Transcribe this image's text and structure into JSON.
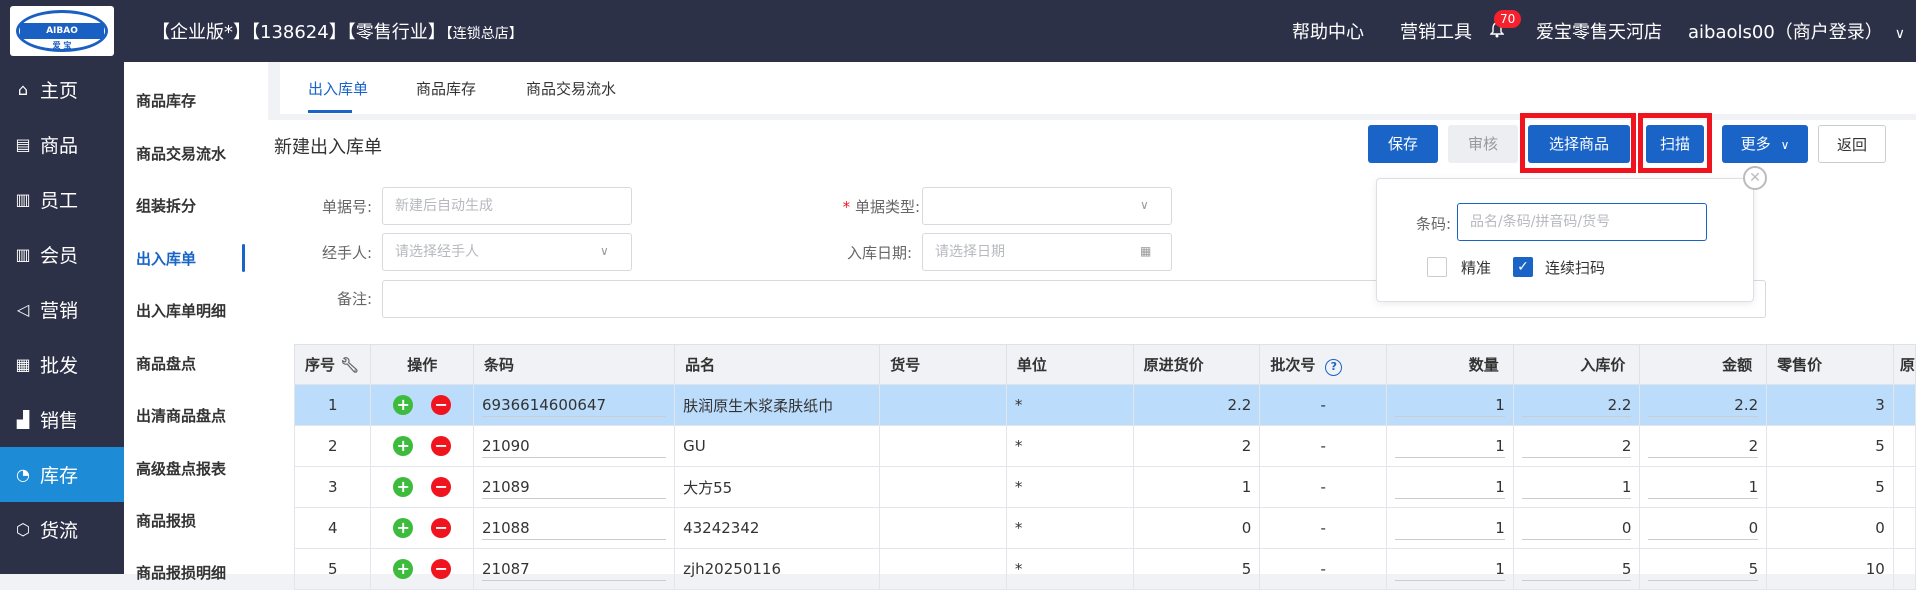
{
  "header": {
    "logo_text": "AIBAO",
    "logo_sub": "爱 宝",
    "title": "【企业版*】【138624】【零售行业】",
    "title_small": "【连锁总店】",
    "help": "帮助中心",
    "marketing_tools": "营销工具",
    "notif_count": "70",
    "store": "爱宝零售天河店",
    "account": "aibaols00（商户登录）"
  },
  "sidebar": {
    "items": [
      {
        "label": "主页",
        "icon": "home-icon"
      },
      {
        "label": "商品",
        "icon": "product-icon"
      },
      {
        "label": "员工",
        "icon": "staff-icon"
      },
      {
        "label": "会员",
        "icon": "member-icon"
      },
      {
        "label": "营销",
        "icon": "marketing-icon"
      },
      {
        "label": "批发",
        "icon": "wholesale-icon"
      },
      {
        "label": "销售",
        "icon": "sales-icon"
      },
      {
        "label": "库存",
        "icon": "inventory-icon"
      },
      {
        "label": "货流",
        "icon": "logistics-icon"
      }
    ],
    "active": "库存"
  },
  "subnav": {
    "items": [
      "商品库存",
      "商品交易流水",
      "组装拆分",
      "出入库单",
      "出入库单明细",
      "商品盘点",
      "出清商品盘点",
      "高级盘点报表",
      "商品报损",
      "商品报损明细"
    ],
    "active": "出入库单"
  },
  "tabs": [
    "出入库单",
    "商品库存",
    "商品交易流水"
  ],
  "page": {
    "title": "新建出入库单",
    "buttons": {
      "save": "保存",
      "review": "审核",
      "select": "选择商品",
      "scan": "扫描",
      "more": "更多",
      "back": "返回"
    }
  },
  "form": {
    "doc_no_label": "单据号:",
    "doc_no_placeholder": "新建后自动生成",
    "doc_type_label": "单据类型:",
    "handler_label": "经手人:",
    "handler_placeholder": "请选择经手人",
    "date_label": "入库日期:",
    "date_placeholder": "请选择日期",
    "remark_label": "备注:"
  },
  "scan_popup": {
    "barcode_label": "条码:",
    "barcode_placeholder": "品名/条码/拼音码/货号",
    "exact_label": "精准",
    "exact_checked": false,
    "continuous_label": "连续扫码",
    "continuous_checked": true
  },
  "table": {
    "columns": [
      "序号",
      "操作",
      "条码",
      "品名",
      "货号",
      "单位",
      "原进货价",
      "批次号",
      "数量",
      "入库价",
      "金额",
      "零售价",
      "原"
    ],
    "rows": [
      {
        "no": "1",
        "barcode": "6936614600647",
        "name": "肤润原生木浆柔肤纸巾",
        "sku": "",
        "unit": "*",
        "orig_price": "2.2",
        "batch": "-",
        "qty": "1",
        "in_price": "2.2",
        "amount": "2.2",
        "retail": "3"
      },
      {
        "no": "2",
        "barcode": "21090",
        "name": "GU",
        "sku": "",
        "unit": "*",
        "orig_price": "2",
        "batch": "-",
        "qty": "1",
        "in_price": "2",
        "amount": "2",
        "retail": "5"
      },
      {
        "no": "3",
        "barcode": "21089",
        "name": "大方55",
        "sku": "",
        "unit": "*",
        "orig_price": "1",
        "batch": "-",
        "qty": "1",
        "in_price": "1",
        "amount": "1",
        "retail": "5"
      },
      {
        "no": "4",
        "barcode": "21088",
        "name": "43242342",
        "sku": "",
        "unit": "*",
        "orig_price": "0",
        "batch": "-",
        "qty": "1",
        "in_price": "0",
        "amount": "0",
        "retail": "0"
      },
      {
        "no": "5",
        "barcode": "21087",
        "name": "zjh20250116",
        "sku": "",
        "unit": "*",
        "orig_price": "5",
        "batch": "-",
        "qty": "1",
        "in_price": "5",
        "amount": "5",
        "retail": "10"
      }
    ]
  },
  "colors": {
    "accent": "#1a64c8",
    "sidebar_bg": "#2d3148",
    "highlight": "#f0141e",
    "selected_row": "#bcdcfb"
  }
}
